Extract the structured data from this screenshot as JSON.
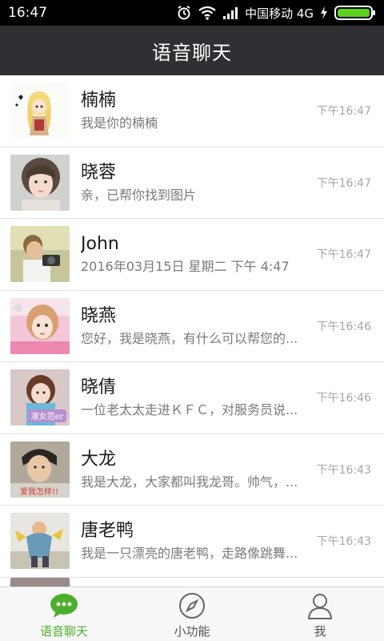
{
  "status_bar": {
    "time": "16:47",
    "carrier": "中国移动 4G",
    "icons": [
      "alarm-icon",
      "wifi-icon",
      "signal-icon",
      "charging-icon",
      "battery-icon"
    ]
  },
  "header": {
    "title": "语音聊天"
  },
  "chats": [
    {
      "name": "楠楠",
      "message": "我是你的楠楠",
      "time": "下午16:47",
      "avatar": "avatar-nannan"
    },
    {
      "name": "晓蓉",
      "message": "亲，已帮你找到图片",
      "time": "下午16:47",
      "avatar": "avatar-xiaorong"
    },
    {
      "name": "John",
      "message": "2016年03月15日 星期二 下午 4:47",
      "time": "下午16:47",
      "avatar": "avatar-john"
    },
    {
      "name": "晓燕",
      "message": "您好，我是晓燕，有什么可以帮您的...",
      "time": "下午16:46",
      "avatar": "avatar-xiaoyan"
    },
    {
      "name": "晓倩",
      "message": "一位老太太走进ＫＦＣ，对服务员说...",
      "time": "下午16:46",
      "avatar": "avatar-xiaoqian"
    },
    {
      "name": "大龙",
      "message": "我是大龙，大家都叫我龙哥。帅气，...",
      "time": "下午16:43",
      "avatar": "avatar-dalong"
    },
    {
      "name": "唐老鸭",
      "message": "我是一只漂亮的唐老鸭，走路像跳舞...",
      "time": "下午16:43",
      "avatar": "avatar-tanglaoya"
    }
  ],
  "avatar_texts": {
    "xiaoqian": "淑女范er",
    "dalong": "爱我怎样!!"
  },
  "tabs": [
    {
      "label": "语音聊天",
      "icon": "chat-bubble-icon",
      "active": true
    },
    {
      "label": "小功能",
      "icon": "compass-icon",
      "active": false
    },
    {
      "label": "我",
      "icon": "person-icon",
      "active": false
    }
  ],
  "colors": {
    "accent": "#4caf2c",
    "header_bg": "#2f3034",
    "status_bg": "#000000",
    "time_text": "#a6a6a6"
  }
}
